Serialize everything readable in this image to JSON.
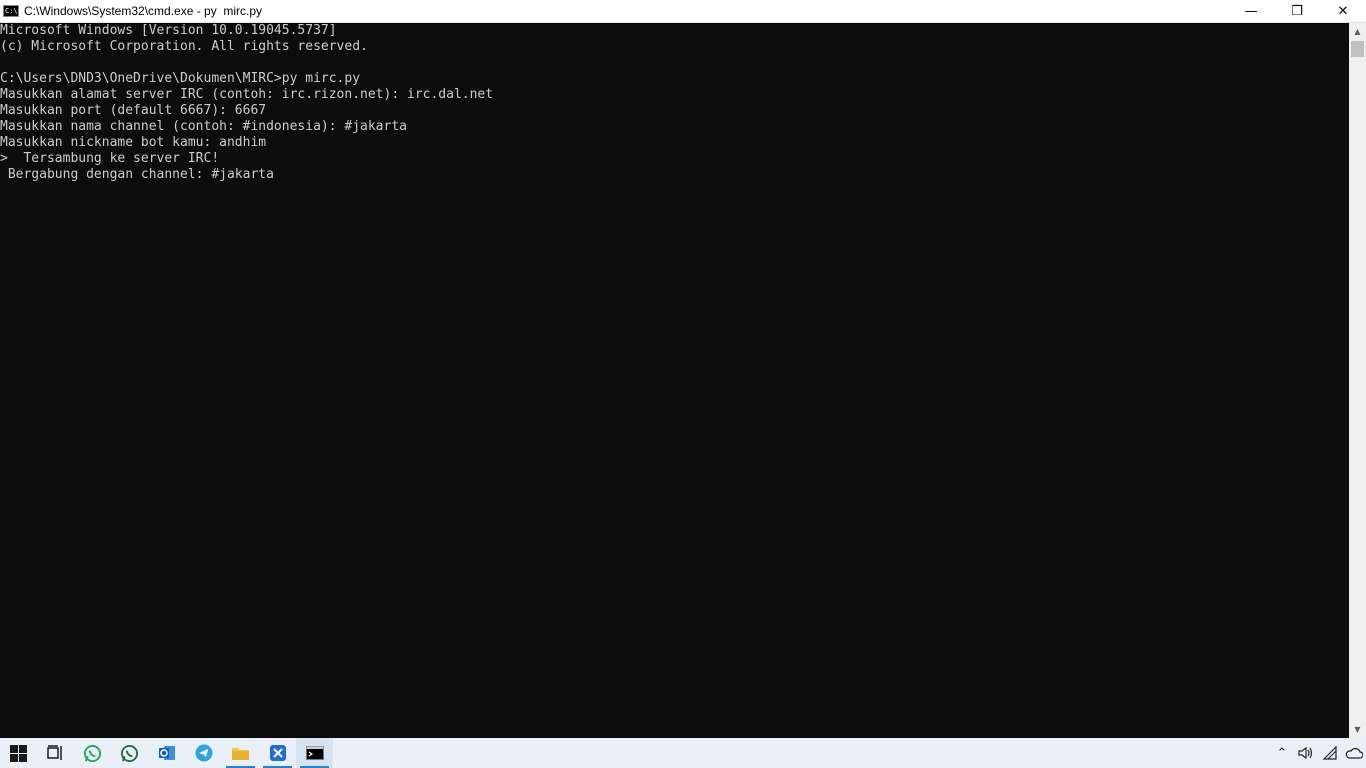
{
  "window": {
    "title": "C:\\Windows\\System32\\cmd.exe - py  mirc.py",
    "icon": "cmd-icon",
    "icon_glyph": "C:\\",
    "controls": {
      "minimize": "—",
      "restore": "❐",
      "close": "✕"
    }
  },
  "console": {
    "text_color": "#cccccc",
    "background": "#0c0c0c",
    "lines": [
      "Microsoft Windows [Version 10.0.19045.5737]",
      "(c) Microsoft Corporation. All rights reserved.",
      "",
      "C:\\Users\\DND3\\OneDrive\\Dokumen\\MIRC>py mirc.py",
      "Masukkan alamat server IRC (contoh: irc.rizon.net): irc.dal.net",
      "Masukkan port (default 6667): 6667",
      "Masukkan nama channel (contoh: #indonesia): #jakarta",
      "Masukkan nickname bot kamu: andhim",
      ">  Tersambung ke server IRC!",
      " Bergabung dengan channel: #jakarta"
    ]
  },
  "scrollbar": {
    "up_arrow": "▲",
    "down_arrow": "▼"
  },
  "taskbar": {
    "items": [
      {
        "name": "start-button-icon",
        "icon": "windows-logo"
      },
      {
        "name": "task-view-icon",
        "icon": "task-view"
      },
      {
        "name": "whatsapp-icon",
        "icon": "whatsapp"
      },
      {
        "name": "whatsapp-business-icon",
        "icon": "whatsapp"
      },
      {
        "name": "outlook-icon",
        "icon": "outlook"
      },
      {
        "name": "telegram-icon",
        "icon": "telegram"
      },
      {
        "name": "file-explorer-icon",
        "icon": "folder"
      },
      {
        "name": "app-icon",
        "icon": "blue-app"
      },
      {
        "name": "cmd-taskbar-icon",
        "icon": "cmd"
      }
    ],
    "tray": {
      "chevron": "⌃",
      "volume": "🔊",
      "wifi": "wifi",
      "cloud": "onedrive"
    },
    "accent": "#2d7dd2"
  }
}
